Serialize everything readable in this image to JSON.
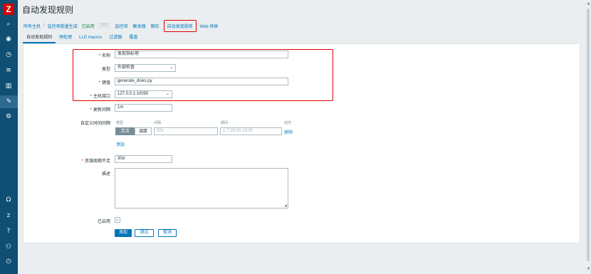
{
  "sidebar": {
    "logo": "Z",
    "nav": [
      {
        "name": "search-icon",
        "glyph": "⌕"
      },
      {
        "name": "eye-icon",
        "glyph": "◉"
      },
      {
        "name": "clock-icon",
        "glyph": "◷"
      },
      {
        "name": "list-icon",
        "glyph": "≡"
      },
      {
        "name": "chart-icon",
        "glyph": "▥"
      },
      {
        "name": "wrench-icon",
        "glyph": "✎"
      },
      {
        "name": "gear-icon",
        "glyph": "⚙"
      }
    ],
    "bottom": [
      {
        "name": "support-icon",
        "glyph": "Ω"
      },
      {
        "name": "share-icon",
        "glyph": "Z"
      },
      {
        "name": "help-icon",
        "glyph": "?"
      },
      {
        "name": "user-icon",
        "glyph": "⚇"
      },
      {
        "name": "logout-icon",
        "glyph": "⏻"
      }
    ]
  },
  "header": {
    "title": "自动发现规则"
  },
  "breadcrumb": {
    "all_hosts": "所有主机",
    "separator": "/",
    "host": "监控项批量生成",
    "status": "已启用",
    "zbx_badge": "ZBX",
    "items": "监控项",
    "triggers": "触发器",
    "graphs": "图形",
    "discovery": "自动发现规则",
    "web": "Web 场景"
  },
  "tabs": [
    "自动发现规则",
    "预处理",
    "LLD macros",
    "过滤器",
    "覆盖"
  ],
  "form": {
    "name_label": "名称",
    "name_value": "发现指标项",
    "type_label": "类型",
    "type_value": "外部检查",
    "key_label": "键值",
    "key_value": "generate_disks.py",
    "interface_label": "主机接口",
    "interface_value": "127.0.0.1:10050",
    "interval_label": "更新间隔",
    "interval_value": "1m",
    "custom_label": "自定义时间间隔",
    "custom_headers": {
      "type": "类型",
      "interval": "间隔",
      "period": "期间",
      "action": "动作"
    },
    "custom_row": {
      "flexible": "灵活",
      "scheduling": "调度",
      "interval_placeholder": "50s",
      "period_placeholder": "1-7,00:00-24:00",
      "remove": "移除"
    },
    "custom_add": "添加",
    "lifetime_label": "资源周期不足",
    "lifetime_value": "30d",
    "description_label": "描述",
    "enabled_label": "已启用",
    "checkmark": "✓"
  },
  "buttons": {
    "add": "添加",
    "test": "测试",
    "cancel": "取消"
  },
  "scrollbar": {
    "up": "▲",
    "down": "▼"
  }
}
